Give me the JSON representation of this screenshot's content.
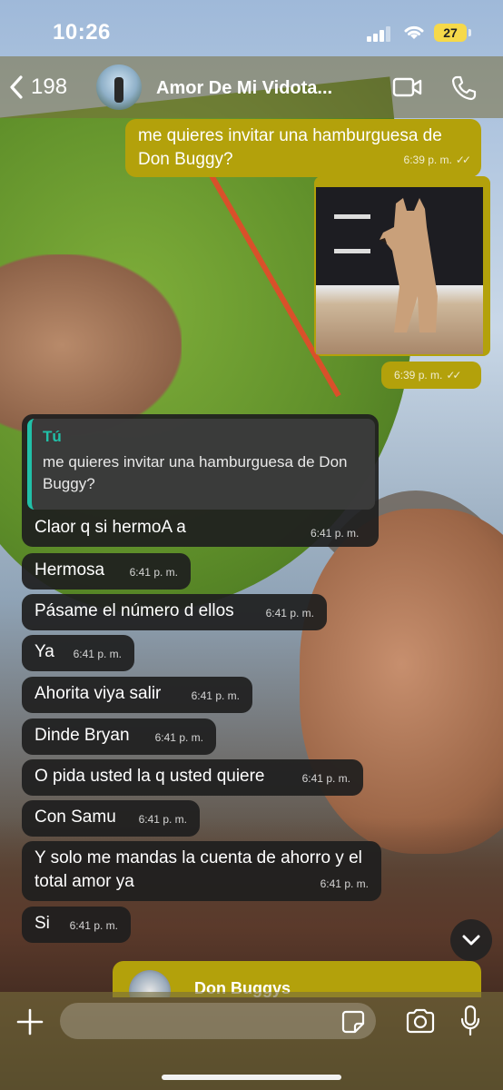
{
  "status_bar": {
    "time": "10:26",
    "battery": "27"
  },
  "header": {
    "back_count": "198",
    "contact_name": "Amor De Mi Vidota..."
  },
  "messages": {
    "m1": {
      "text": "me quieres invitar una hamburguesa de Don Buggy?",
      "time": "6:39 p. m."
    },
    "m2": {
      "time": "6:39 p. m."
    },
    "m3": {
      "quote_author": "Tú",
      "quote_text": "me quieres invitar una hamburguesa de Don Buggy?",
      "text": "Claor q si hermoA a",
      "time": "6:41 p. m."
    },
    "m4": {
      "text": "Hermosa",
      "time": "6:41 p. m."
    },
    "m5": {
      "text": "Pásame el número d ellos",
      "time": "6:41 p. m."
    },
    "m6": {
      "text": "Ya",
      "time": "6:41 p. m."
    },
    "m7": {
      "text": "Ahorita viya salir",
      "time": "6:41 p. m."
    },
    "m8": {
      "text": "Dinde Bryan",
      "time": "6:41 p. m."
    },
    "m9": {
      "text": "O pida usted la q usted quiere",
      "time": "6:41 p. m."
    },
    "m10": {
      "text": "Con Samu",
      "time": "6:41 p. m."
    },
    "m11": {
      "text": "Y solo me mandas la cuenta de ahorro y el total amor ya",
      "time": "6:41 p. m."
    },
    "m12": {
      "text": "Si",
      "time": "6:41 p. m."
    }
  },
  "preview": {
    "title": "Don Buggys"
  },
  "composer": {
    "placeholder": ""
  },
  "colors": {
    "outgoing_bubble": "#b3a10b",
    "incoming_bubble": "#1e1e1e",
    "quote_accent": "#21c0a8",
    "battery": "#f6d94a"
  },
  "icons": [
    "back-chevron-icon",
    "video-call-icon",
    "phone-icon",
    "plus-icon",
    "sticker-icon",
    "camera-icon",
    "microphone-icon",
    "chevron-down-icon",
    "double-check-icon"
  ]
}
